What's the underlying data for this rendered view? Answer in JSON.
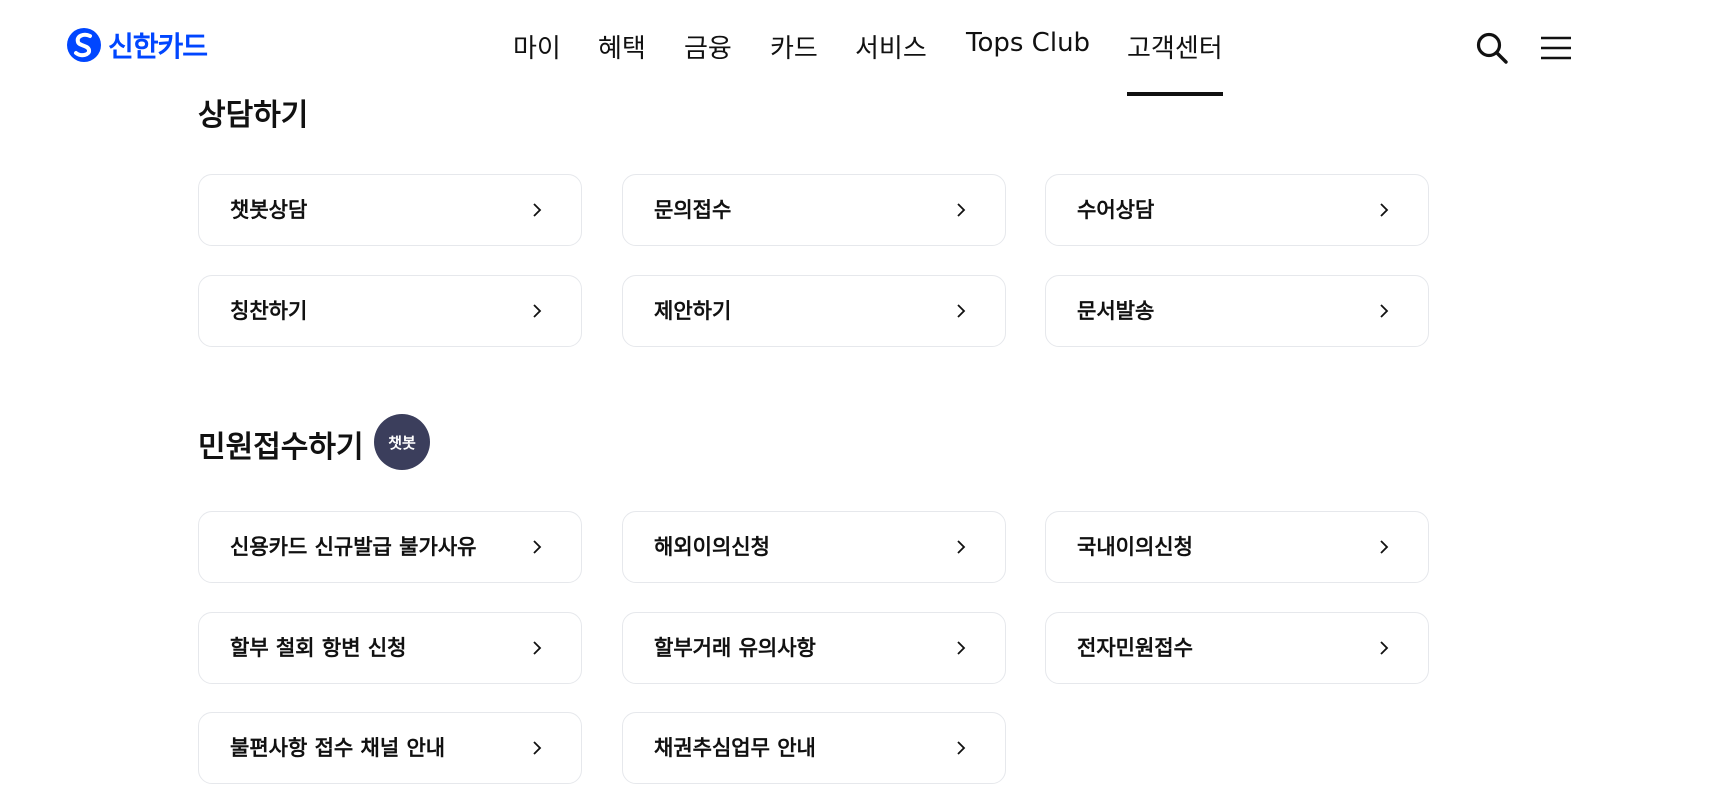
{
  "header": {
    "logo_text": "신한카드",
    "nav": [
      {
        "label": "마이"
      },
      {
        "label": "혜택"
      },
      {
        "label": "금융"
      },
      {
        "label": "카드"
      },
      {
        "label": "서비스"
      },
      {
        "label": "Tops Club"
      },
      {
        "label": "고객센터",
        "active": true
      }
    ],
    "icons": [
      "search-icon",
      "menu-icon"
    ],
    "brand_color": "#0046ff"
  },
  "sections": [
    {
      "title": "상담하기",
      "items": [
        {
          "label": "챗봇상담"
        },
        {
          "label": "문의접수"
        },
        {
          "label": "수어상담"
        },
        {
          "label": "칭찬하기"
        },
        {
          "label": "제안하기"
        },
        {
          "label": "문서발송"
        }
      ]
    },
    {
      "title": "민원접수하기",
      "badge": "챗봇",
      "badge_color": "#3b3e5c",
      "items": [
        {
          "label": "신용카드 신규발급 불가사유"
        },
        {
          "label": "해외이의신청"
        },
        {
          "label": "국내이의신청"
        },
        {
          "label": "할부 철회 항변 신청"
        },
        {
          "label": "할부거래 유의사항"
        },
        {
          "label": "전자민원접수"
        },
        {
          "label": "불편사항 접수 채널 안내"
        },
        {
          "label": "채권추심업무 안내"
        }
      ]
    }
  ]
}
